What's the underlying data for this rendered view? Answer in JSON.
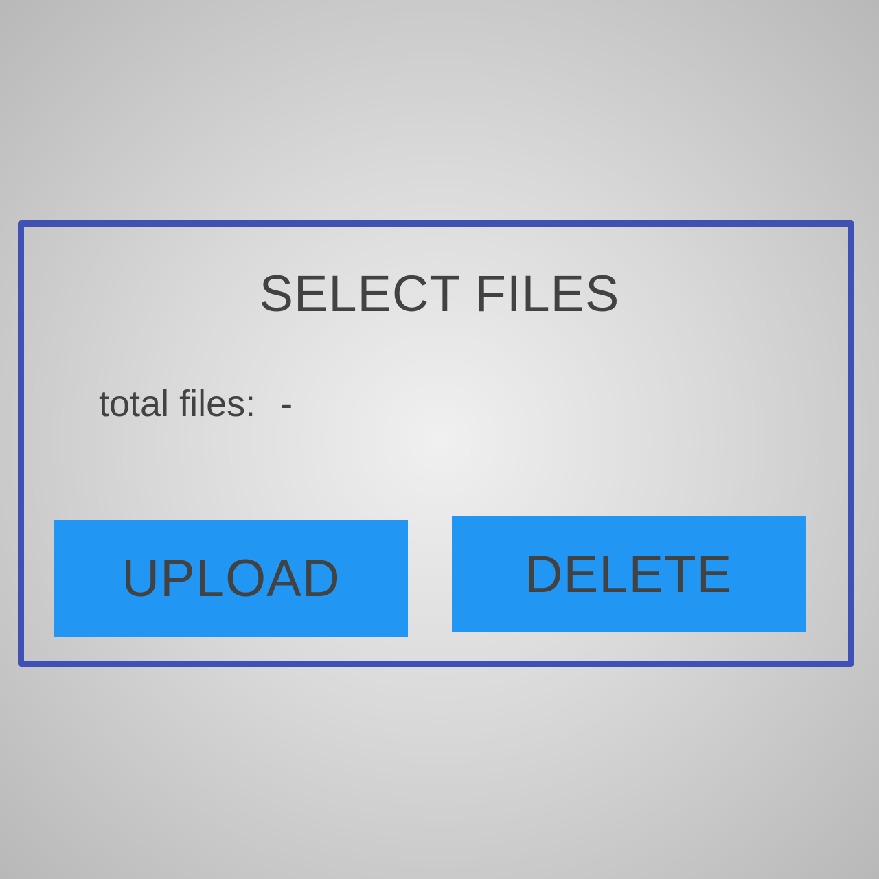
{
  "dialog": {
    "title": "SELECT FILES",
    "total_files_label": "total files:",
    "total_files_value": "-",
    "upload_label": "UPLOAD",
    "delete_label": "DELETE"
  },
  "colors": {
    "border": "#3f51b5",
    "button_background": "#2196f3",
    "text": "#424242",
    "background_center": "#f0f0f0",
    "background_edge": "#b8b8b8"
  }
}
